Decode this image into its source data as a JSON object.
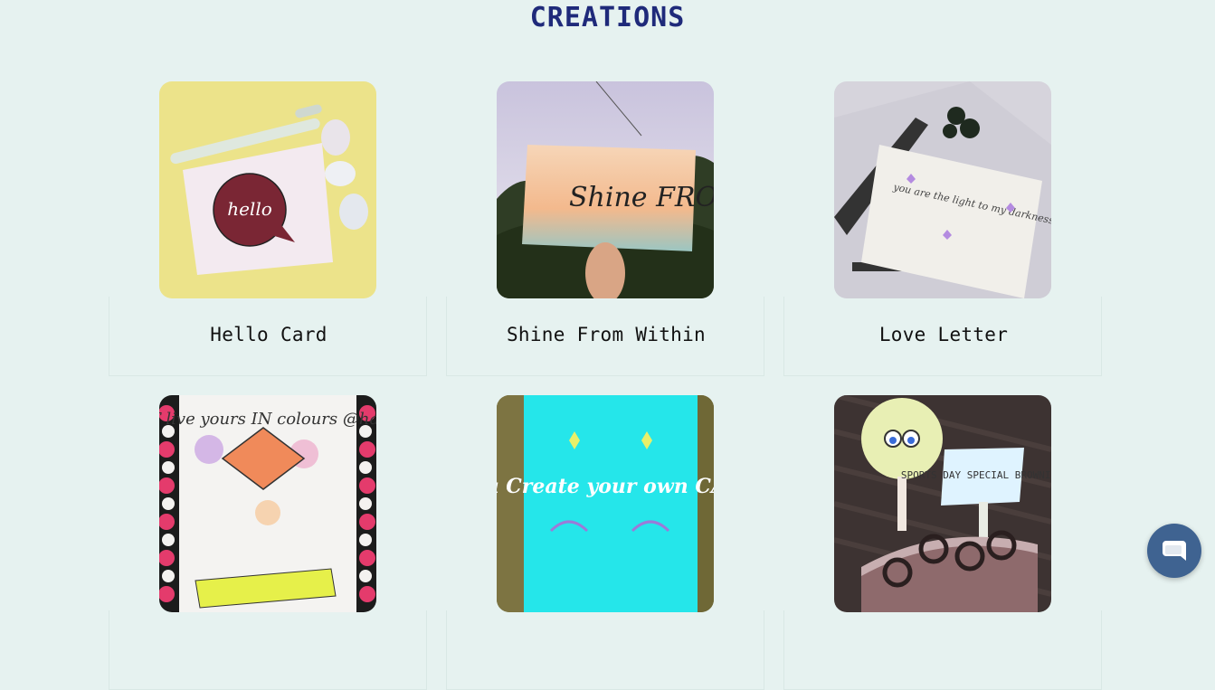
{
  "header": {
    "title": "CREATIONS"
  },
  "creations": [
    {
      "title": "Hello Card",
      "image_text": "hello"
    },
    {
      "title": "Shine From Within",
      "image_text": "Shine FROM WITHIN"
    },
    {
      "title": "Love Letter",
      "image_text": "you are the light to my darkness answers of my questions meaning of my life my sunshine"
    },
    {
      "title": "",
      "image_text": "life is ART live yours IN colours @handpursuit"
    },
    {
      "title": "",
      "image_text": "You Create your own CALM"
    },
    {
      "title": "",
      "image_text": "SPORTS DAY SPECIAL BROWNIE"
    }
  ],
  "chat_widget": {
    "icon": "chat-bubble-icon",
    "color": "#3f6391"
  },
  "colors": {
    "background": "#e6f2f0",
    "title": "#1f2a7a"
  }
}
